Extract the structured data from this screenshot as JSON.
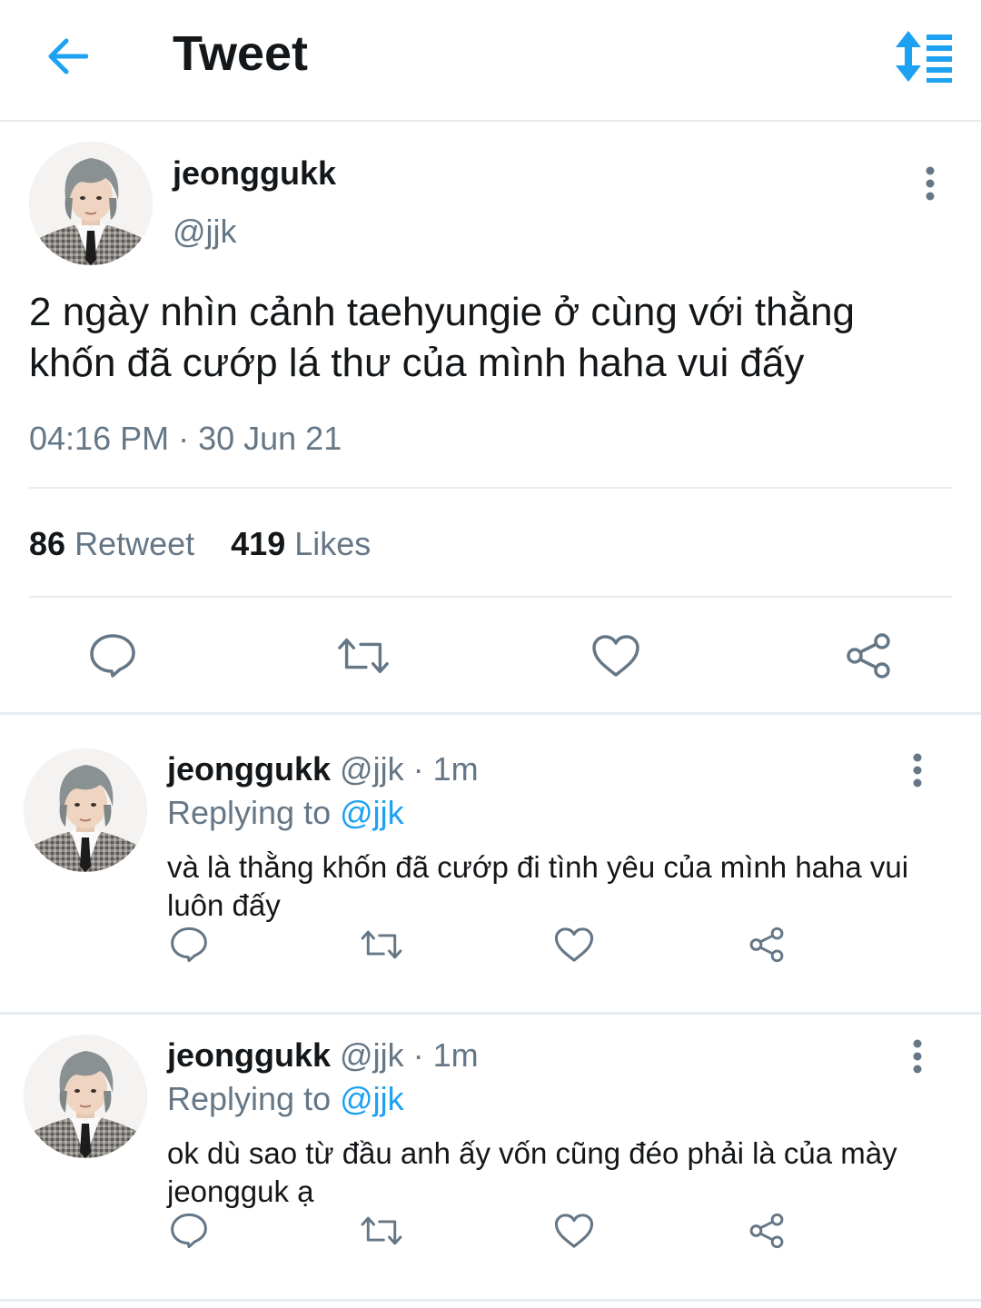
{
  "header": {
    "back_icon": "arrow-left-icon",
    "title": "Tweet",
    "sort_icon": "sort-list-icon"
  },
  "colors": {
    "accent": "#1da1f2",
    "text": "#14171a",
    "muted": "#657786",
    "divider": "#e6ecf0"
  },
  "main_tweet": {
    "name": "jeonggukk",
    "handle": "@jjk",
    "text": "2 ngày nhìn cảnh taehyungie ở cùng với thằng khốn đã cướp lá thư của mình haha vui đấy",
    "time": "04:16 PM · 30 Jun 21",
    "retweet_count": "86",
    "retweet_label": "Retweet",
    "like_count": "419",
    "like_label": "Likes"
  },
  "replies": [
    {
      "name": "jeonggukk",
      "handle": "@jjk",
      "age": "· 1m",
      "replying_label": "Replying to",
      "replying_to": "@jjk",
      "text": "và là thằng khốn đã cướp đi tình yêu của mình haha vui luôn đấy"
    },
    {
      "name": "jeonggukk",
      "handle": "@jjk",
      "age": "· 1m",
      "replying_label": "Replying to",
      "replying_to": "@jjk",
      "text": "ok dù sao từ đầu anh ấy vốn cũng đéo phải là của mày jeongguk ạ"
    }
  ]
}
